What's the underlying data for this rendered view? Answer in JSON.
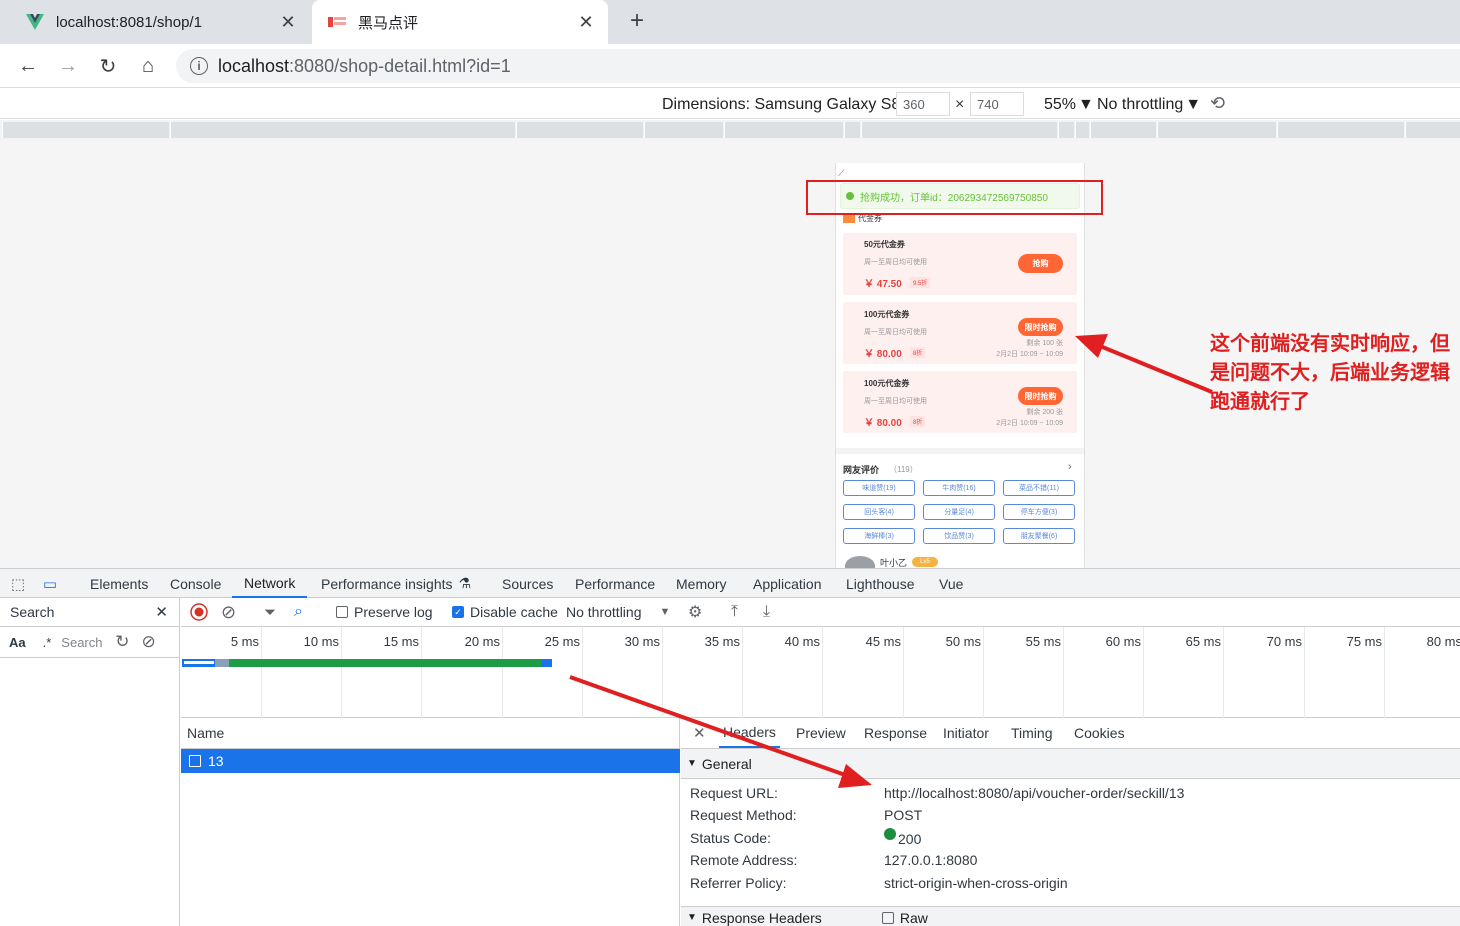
{
  "browser": {
    "tabs": [
      {
        "title": "localhost:8081/shop/1",
        "favicon": "vue-icon"
      },
      {
        "title": "黑马点评",
        "favicon": "site-icon"
      }
    ],
    "url_host": "localhost",
    "url_rest": ":8080/shop-detail.html?id=1"
  },
  "device_toolbar": {
    "dimensions": "Dimensions: Samsung Galaxy S8+",
    "width": "360",
    "height": "740",
    "times": "×",
    "zoom": "55%",
    "throttling": "No throttling"
  },
  "phone": {
    "toast": "抢购成功，订单id：206293472569750850",
    "section_title": "代金券",
    "vouchers": [
      {
        "name": "50元代金券",
        "rule": "周一至周日均可使用",
        "price": "￥ 47.50",
        "discount": "9.5折",
        "button": "抢购",
        "stock": "",
        "time": ""
      },
      {
        "name": "100元代金券",
        "rule": "周一至周日均可使用",
        "price": "￥ 80.00",
        "discount": "8折",
        "button": "限时抢购",
        "stock": "剩余 100 张",
        "time": "2月2日 10:09 ~ 10:09"
      },
      {
        "name": "100元代金券",
        "rule": "周一至周日均可使用",
        "price": "￥ 80.00",
        "discount": "8折",
        "button": "限时抢购",
        "stock": "剩余 200 张",
        "time": "2月2日 10:09 ~ 10:09"
      }
    ],
    "reviews_title": "网友评价",
    "reviews_count": "（119）",
    "review_tags": [
      "味道赞(19)",
      "牛肉赞(16)",
      "菜品不错(11)",
      "回头客(4)",
      "分量足(4)",
      "停车方便(3)",
      "海鲜棒(3)",
      "饮品赞(3)",
      "朋友聚餐(6)"
    ],
    "user_name": "叶小乙",
    "user_level": "Lv5"
  },
  "annotation": "这个前端没有实时响应，但是问题不大，后端业务逻辑跑通就行了",
  "devtools": {
    "tabs": [
      "Elements",
      "Console",
      "Network",
      "Performance insights",
      "Sources",
      "Performance",
      "Memory",
      "Application",
      "Lighthouse",
      "Vue"
    ],
    "search_title": "Search",
    "search_placeholder": "Search",
    "case_toggle": "Aa",
    "regex_toggle": ".*",
    "preserve_log": "Preserve log",
    "disable_cache": "Disable cache",
    "throttling": "No throttling",
    "timeline_ticks": [
      "5 ms",
      "10 ms",
      "15 ms",
      "20 ms",
      "25 ms",
      "30 ms",
      "35 ms",
      "40 ms",
      "45 ms",
      "50 ms",
      "55 ms",
      "60 ms",
      "65 ms",
      "70 ms",
      "75 ms",
      "80 ms"
    ],
    "name_header": "Name",
    "request_name": "13",
    "detail_tabs": [
      "Headers",
      "Preview",
      "Response",
      "Initiator",
      "Timing",
      "Cookies"
    ],
    "general_title": "General",
    "general": [
      {
        "key": "Request URL:",
        "value": "http://localhost:8080/api/voucher-order/seckill/13"
      },
      {
        "key": "Request Method:",
        "value": "POST"
      },
      {
        "key": "Status Code:",
        "value": "200"
      },
      {
        "key": "Remote Address:",
        "value": "127.0.0.1:8080"
      },
      {
        "key": "Referrer Policy:",
        "value": "strict-origin-when-cross-origin"
      }
    ],
    "response_headers_title": "Response Headers",
    "raw_label": "Raw"
  }
}
